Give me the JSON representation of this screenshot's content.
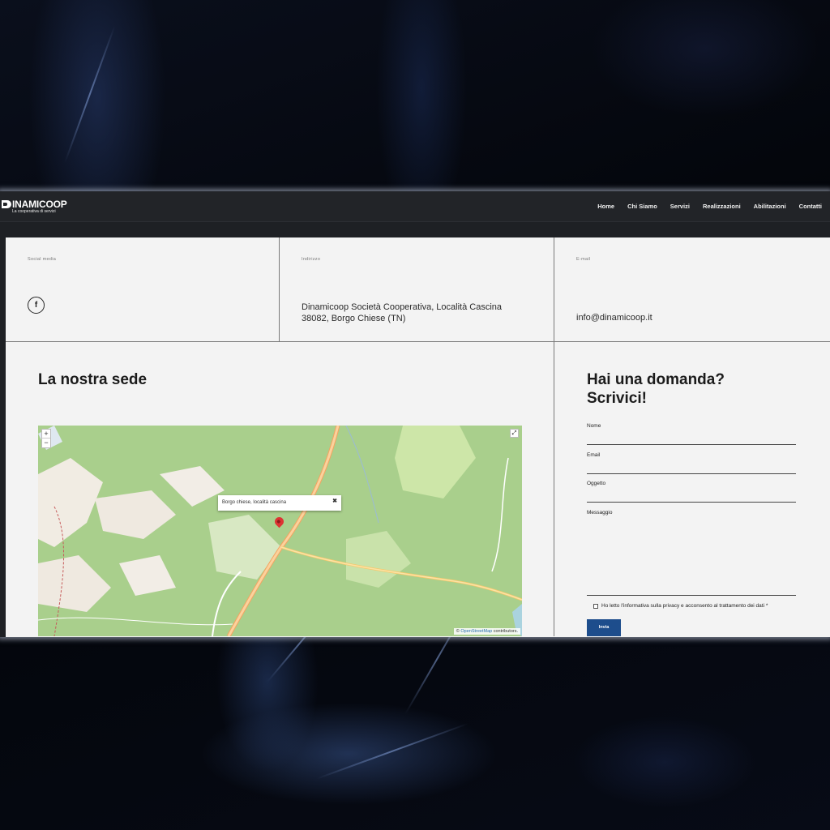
{
  "header": {
    "logo_text": "INAMICOOP",
    "logo_subtitle": "La cooperativa di servizi",
    "menu": [
      "Home",
      "Chi Siamo",
      "Servizi",
      "Realizzazioni",
      "Abilitazioni",
      "Contatti"
    ]
  },
  "info": {
    "social_label": "Social media",
    "social_icon": "facebook-icon",
    "social_glyph": "f",
    "address_label": "Indirizzo",
    "address_line1": "Dinamicoop Società Cooperativa, Località Cascina",
    "address_line2": "38082, Borgo Chiese (TN)",
    "email_label": "E-mail",
    "email": "info@dinamicoop.it"
  },
  "location": {
    "title": "La nostra sede",
    "map": {
      "zoom_in": "+",
      "zoom_out": "−",
      "fullscreen": "⤢",
      "popup_text": "Borgo chiese, località cascina",
      "popup_close": "✖",
      "attribution_prefix": "© ",
      "attribution_link": "OpenStreetMap",
      "attribution_suffix": " contributors."
    }
  },
  "form": {
    "title": "Hai una domanda? Scrivici!",
    "fields": {
      "name": "Nome",
      "email": "Email",
      "subject": "Oggetto",
      "message": "Messaggio"
    },
    "consent": "Ho letto l'informativa sulla privacy e acconsento al trattamento dei dati *",
    "submit": "Invia"
  },
  "colors": {
    "nav_bg": "#222428",
    "page_bg": "#f3f3f3",
    "button_bg": "#1d4d8c",
    "map_green": "#a9cf8c"
  }
}
